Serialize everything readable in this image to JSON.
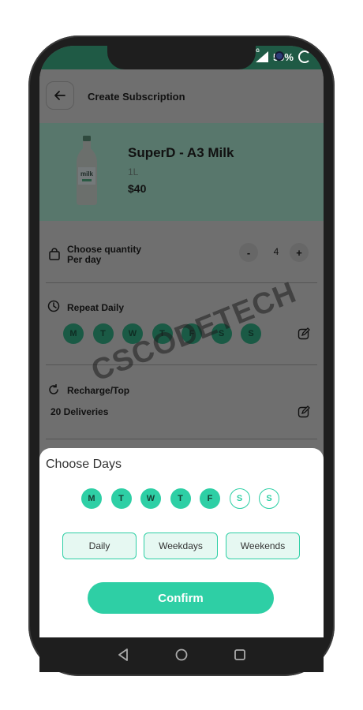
{
  "status_bar": {
    "network": "4G",
    "battery": "59%"
  },
  "app_bar": {
    "title": "Create Subscription"
  },
  "product": {
    "name": "SuperD - A3 Milk",
    "volume": "1L",
    "price": "$40",
    "bottle_label": "milk"
  },
  "quantity": {
    "line1": "Choose quantity",
    "line2": "Per day",
    "minus": "-",
    "plus": "+",
    "value": "4"
  },
  "repeat": {
    "label": "Repeat Daily",
    "days": [
      "M",
      "T",
      "W",
      "T",
      "F",
      "S",
      "S"
    ]
  },
  "recharge": {
    "label": "Recharge/Top",
    "deliveries": "20 Deliveries"
  },
  "watermark": "CSCODETECH",
  "sheet": {
    "title": "Choose Days",
    "days": [
      {
        "label": "M",
        "selected": true
      },
      {
        "label": "T",
        "selected": true
      },
      {
        "label": "W",
        "selected": true
      },
      {
        "label": "T",
        "selected": true
      },
      {
        "label": "F",
        "selected": true
      },
      {
        "label": "S",
        "selected": false
      },
      {
        "label": "S",
        "selected": false
      }
    ],
    "presets": [
      "Daily",
      "Weekdays",
      "Weekends"
    ],
    "confirm": "Confirm"
  },
  "colors": {
    "accent": "#2ecfa5",
    "status_bar": "#1f5a45",
    "overlay": "#6f6f6f"
  },
  "icons": [
    "back-arrow-icon",
    "bag-icon",
    "clock-icon",
    "refresh-icon",
    "edit-icon",
    "nav-back-icon",
    "nav-home-icon",
    "nav-recents-icon"
  ]
}
